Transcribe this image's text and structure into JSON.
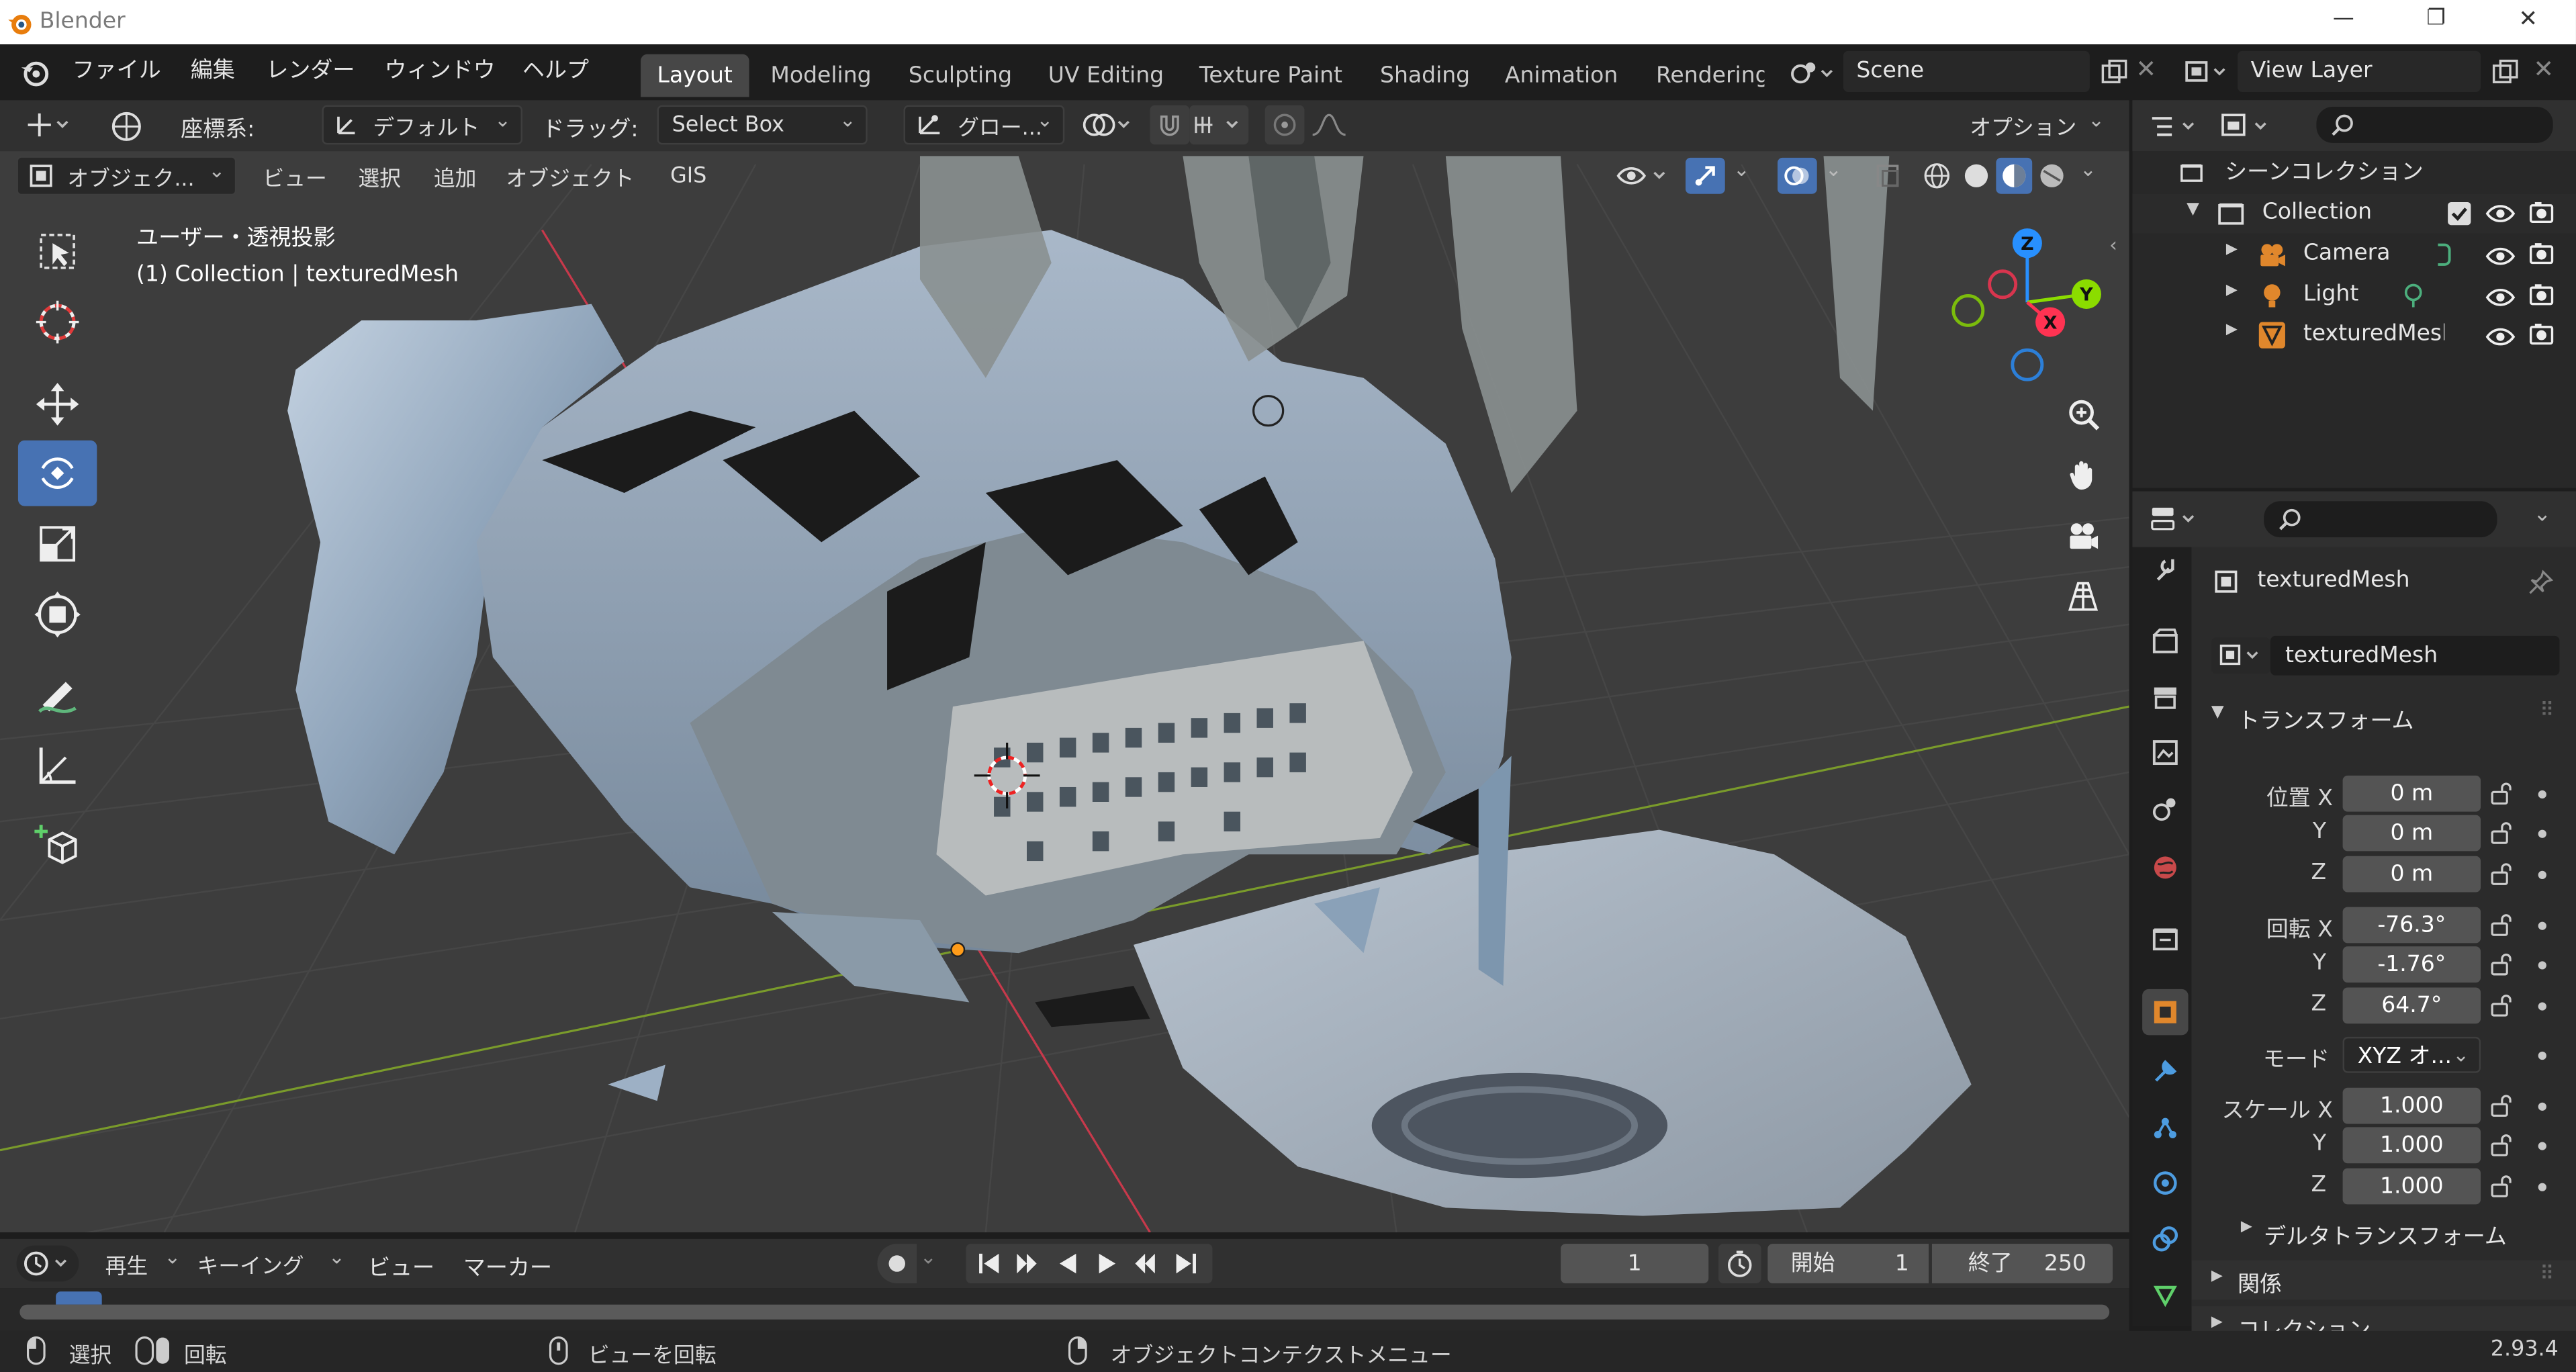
{
  "window": {
    "title": "Blender",
    "minimize": "—",
    "restore": "❐",
    "close": "✕"
  },
  "menu": [
    "ファイル",
    "編集",
    "レンダー",
    "ウィンドウ",
    "ヘルプ"
  ],
  "workspace_tabs": [
    "Layout",
    "Modeling",
    "Sculpting",
    "UV Editing",
    "Texture Paint",
    "Shading",
    "Animation",
    "Rendering"
  ],
  "scene": {
    "name": "Scene"
  },
  "view_layer": {
    "name": "View Layer"
  },
  "header": {
    "coord_label": "座標系:",
    "coord_value": "デフォルト",
    "drag_label": "ドラッグ:",
    "drag_value": "Select Box",
    "pivot_value": "グロー...",
    "options": "オプション"
  },
  "viewport_menu": {
    "mode": "オブジェク...",
    "items": [
      "ビュー",
      "選択",
      "追加",
      "オブジェクト",
      "GIS"
    ]
  },
  "viewport_info": {
    "line1": "ユーザー・透視投影",
    "line2": "(1) Collection | texturedMesh"
  },
  "gizmo": {
    "z": "Z",
    "y": "Y",
    "x": "X"
  },
  "outliner": {
    "root": "シーンコレクション",
    "collection": "Collection",
    "items": [
      "Camera",
      "Light",
      "texturedMesh"
    ]
  },
  "properties": {
    "object_name": "texturedMesh",
    "data_name": "texturedMesh",
    "transform_title": "トランスフォーム",
    "location_label": "位置 X",
    "rotation_label": "回転 X",
    "scale_label": "スケール X",
    "axis_y": "Y",
    "axis_z": "Z",
    "location": [
      "0 m",
      "0 m",
      "0 m"
    ],
    "rotation": [
      "-76.3°",
      "-1.76°",
      "64.7°"
    ],
    "mode_label": "モード",
    "mode_value": "XYZ オ...",
    "scale": [
      "1.000",
      "1.000",
      "1.000"
    ],
    "delta": "デルタトランスフォーム",
    "relations": "関係",
    "collections": "コレクション"
  },
  "timeline": {
    "playback": "再生",
    "keying": "キーイング",
    "view": "ビュー",
    "marker": "マーカー",
    "current_frame": "1",
    "start_label": "開始",
    "start_value": "1",
    "end_label": "終了",
    "end_value": "250"
  },
  "status": {
    "select": "選択",
    "rotate": "回転",
    "rotate_view": "ビューを回転",
    "context_menu": "オブジェクトコンテクストメニュー",
    "version": "2.93.4"
  },
  "colors": {
    "accent": "#4772b3",
    "x_axis": "#ff3352",
    "y_axis": "#8bdc00",
    "z_axis": "#2890ff",
    "header": "#303030",
    "viewport": "#3d3d3d"
  }
}
